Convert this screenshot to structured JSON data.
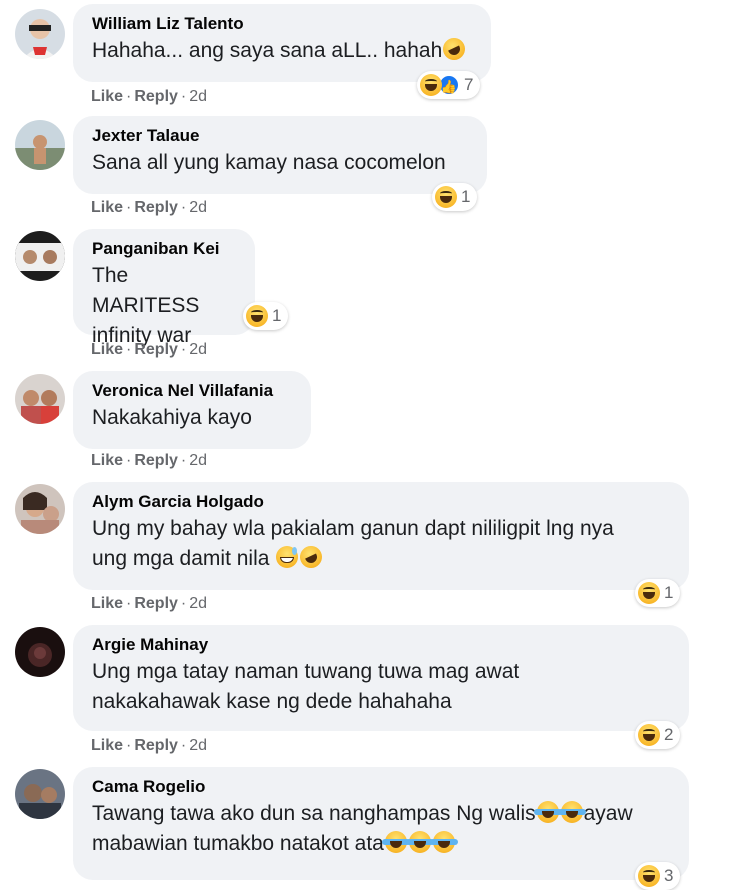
{
  "comments": [
    {
      "author": "William Liz Talento",
      "text": "Hahaha... ang saya sana aLL.. hahah",
      "inline_emojis": [
        "rofl"
      ],
      "reaction_count": "7",
      "reaction_types": [
        "haha",
        "like"
      ],
      "like": "Like",
      "reply": "Reply",
      "time": "2d",
      "avatar_color": "#b9c4cf"
    },
    {
      "author": "Jexter Talaue",
      "text": "Sana all yung kamay nasa cocomelon",
      "inline_emojis": [],
      "reaction_count": "1",
      "reaction_types": [
        "haha"
      ],
      "like": "Like",
      "reply": "Reply",
      "time": "2d",
      "avatar_color": "#8aa0b0"
    },
    {
      "author": "Panganiban Kei",
      "text_lines": [
        "The MARITESS",
        "infinity war"
      ],
      "reaction_count": "1",
      "reaction_types": [
        "haha"
      ],
      "like": "Like",
      "reply": "Reply",
      "time": "2d",
      "avatar_color": "#3a3a3a"
    },
    {
      "author": "Veronica Nel Villafania",
      "text": "Nakakahiya kayo",
      "inline_emojis": [],
      "reaction_count": "",
      "like": "Like",
      "reply": "Reply",
      "time": "2d",
      "avatar_color": "#c0504d"
    },
    {
      "author": "Alym Garcia Holgado",
      "text_lines": [
        "Ung my bahay wla pakialam ganun dapt nililigpit lng nya",
        "ung mga damit nila "
      ],
      "inline_emojis": [
        "sweat",
        "rofl"
      ],
      "reaction_count": "1",
      "reaction_types": [
        "haha"
      ],
      "like": "Like",
      "reply": "Reply",
      "time": "2d",
      "avatar_color": "#a07a6a"
    },
    {
      "author": "Argie Mahinay",
      "text_lines": [
        "Ung mga tatay naman tuwang tuwa mag awat",
        "nakakahawak kase ng dede hahahaha"
      ],
      "reaction_count": "2",
      "reaction_types": [
        "haha"
      ],
      "like": "Like",
      "reply": "Reply",
      "time": "2d",
      "avatar_color": "#3d2020"
    },
    {
      "author": "Cama Rogelio",
      "text_lines": [
        "Tawang tawa ako dun sa nanghampas Ng walis",
        "ayaw",
        "mabawian tumakbo natakot ata"
      ],
      "reaction_count": "3",
      "reaction_types": [
        "haha"
      ],
      "like": "Like",
      "reply": "Reply",
      "time": "2d",
      "avatar_color": "#556070"
    }
  ],
  "colors": {
    "bubble": "#f0f2f5",
    "meta": "#65676b",
    "like_blue": "#1877f2",
    "author": "#050505"
  }
}
